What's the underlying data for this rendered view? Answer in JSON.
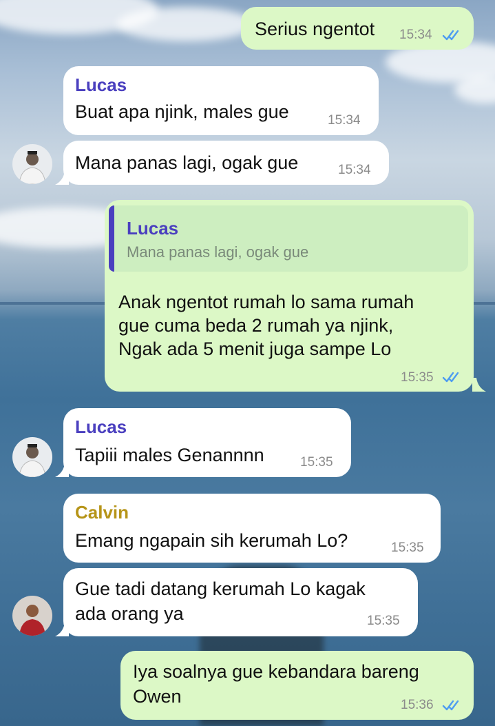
{
  "messages": [
    {
      "text": "Serius ngentot",
      "time": "15:34"
    },
    {
      "sender": "Lucas",
      "text": "Buat apa njink, males gue",
      "time": "15:34"
    },
    {
      "text": "Mana panas lagi, ogak gue",
      "time": "15:34"
    },
    {
      "reply": {
        "sender": "Lucas",
        "text": "Mana panas lagi, ogak gue"
      },
      "lines": [
        "Anak ngentot rumah lo sama rumah",
        "gue cuma beda 2 rumah ya njink,",
        "Ngak ada 5 menit juga sampe Lo"
      ],
      "time": "15:35"
    },
    {
      "sender": "Lucas",
      "text": "Tapiii males Genannnn",
      "time": "15:35"
    },
    {
      "sender": "Calvin",
      "text": "Emang ngapain sih kerumah Lo?",
      "time": "15:35"
    },
    {
      "lines": [
        "Gue tadi datang kerumah Lo kagak",
        "ada orang ya"
      ],
      "time": "15:35"
    },
    {
      "lines": [
        "Iya soalnya gue kebandara bareng",
        "Owen"
      ],
      "time": "15:36"
    }
  ]
}
